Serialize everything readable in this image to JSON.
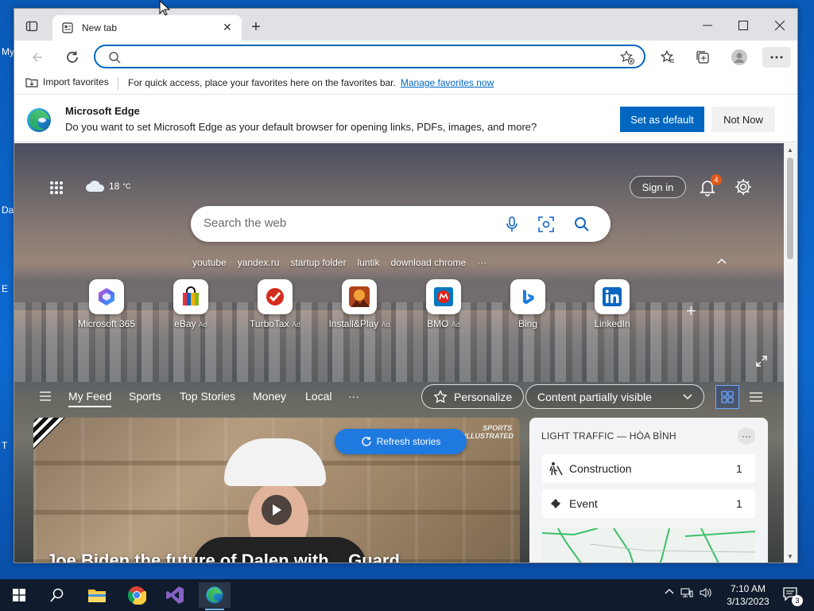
{
  "desktop": {
    "labels": [
      "My",
      "Da",
      "E",
      "T"
    ]
  },
  "browser": {
    "tab_title": "New tab",
    "address": {
      "value": "",
      "placeholder": ""
    },
    "favorites_bar": {
      "import_label": "Import favorites",
      "message": "For quick access, place your favorites here on the favorites bar.",
      "link": "Manage favorites now"
    },
    "infobar": {
      "title": "Microsoft Edge",
      "message": "Do you want to set Microsoft Edge as your default browser for opening links, PDFs, images, and more?",
      "primary": "Set as default",
      "secondary": "Not Now"
    }
  },
  "newtab": {
    "weather": "18",
    "weather_unit": "°C",
    "signin": "Sign in",
    "notifications_count": "4",
    "search_placeholder": "Search the web",
    "trending": [
      "youtube",
      "yandex.ru",
      "startup folder",
      "luntik",
      "download chrome",
      "···"
    ],
    "tiles": [
      {
        "label": "Microsoft 365",
        "ad": ""
      },
      {
        "label": "eBay",
        "ad": "Ad"
      },
      {
        "label": "TurboTax",
        "ad": "Ad"
      },
      {
        "label": "Install&Play",
        "ad": "Ad"
      },
      {
        "label": "BMO",
        "ad": "Ad"
      },
      {
        "label": "Bing",
        "ad": ""
      },
      {
        "label": "LinkedIn",
        "ad": ""
      }
    ],
    "feed_nav": [
      "My Feed",
      "Sports",
      "Top Stories",
      "Money",
      "Local",
      "···"
    ],
    "personalize": "Personalize",
    "content_visibility": "Content partially visible",
    "refresh_stories": "Refresh stories",
    "story_watermark": "SPORTS ILLUSTRATED",
    "story_title_partial": "Joe Biden the future of Dalen with... Guard",
    "traffic": {
      "header": "LIGHT TRAFFIC — HÒA BÌNH",
      "rows": [
        {
          "name": "Construction",
          "count": "1"
        },
        {
          "name": "Event",
          "count": "1"
        }
      ]
    }
  },
  "taskbar": {
    "time": "7:10 AM",
    "date": "3/13/2023",
    "notification_count": "3"
  },
  "colors": {
    "accent": "#0067c0",
    "taskbar": "#101c2d",
    "badge": "#e05a1a"
  }
}
